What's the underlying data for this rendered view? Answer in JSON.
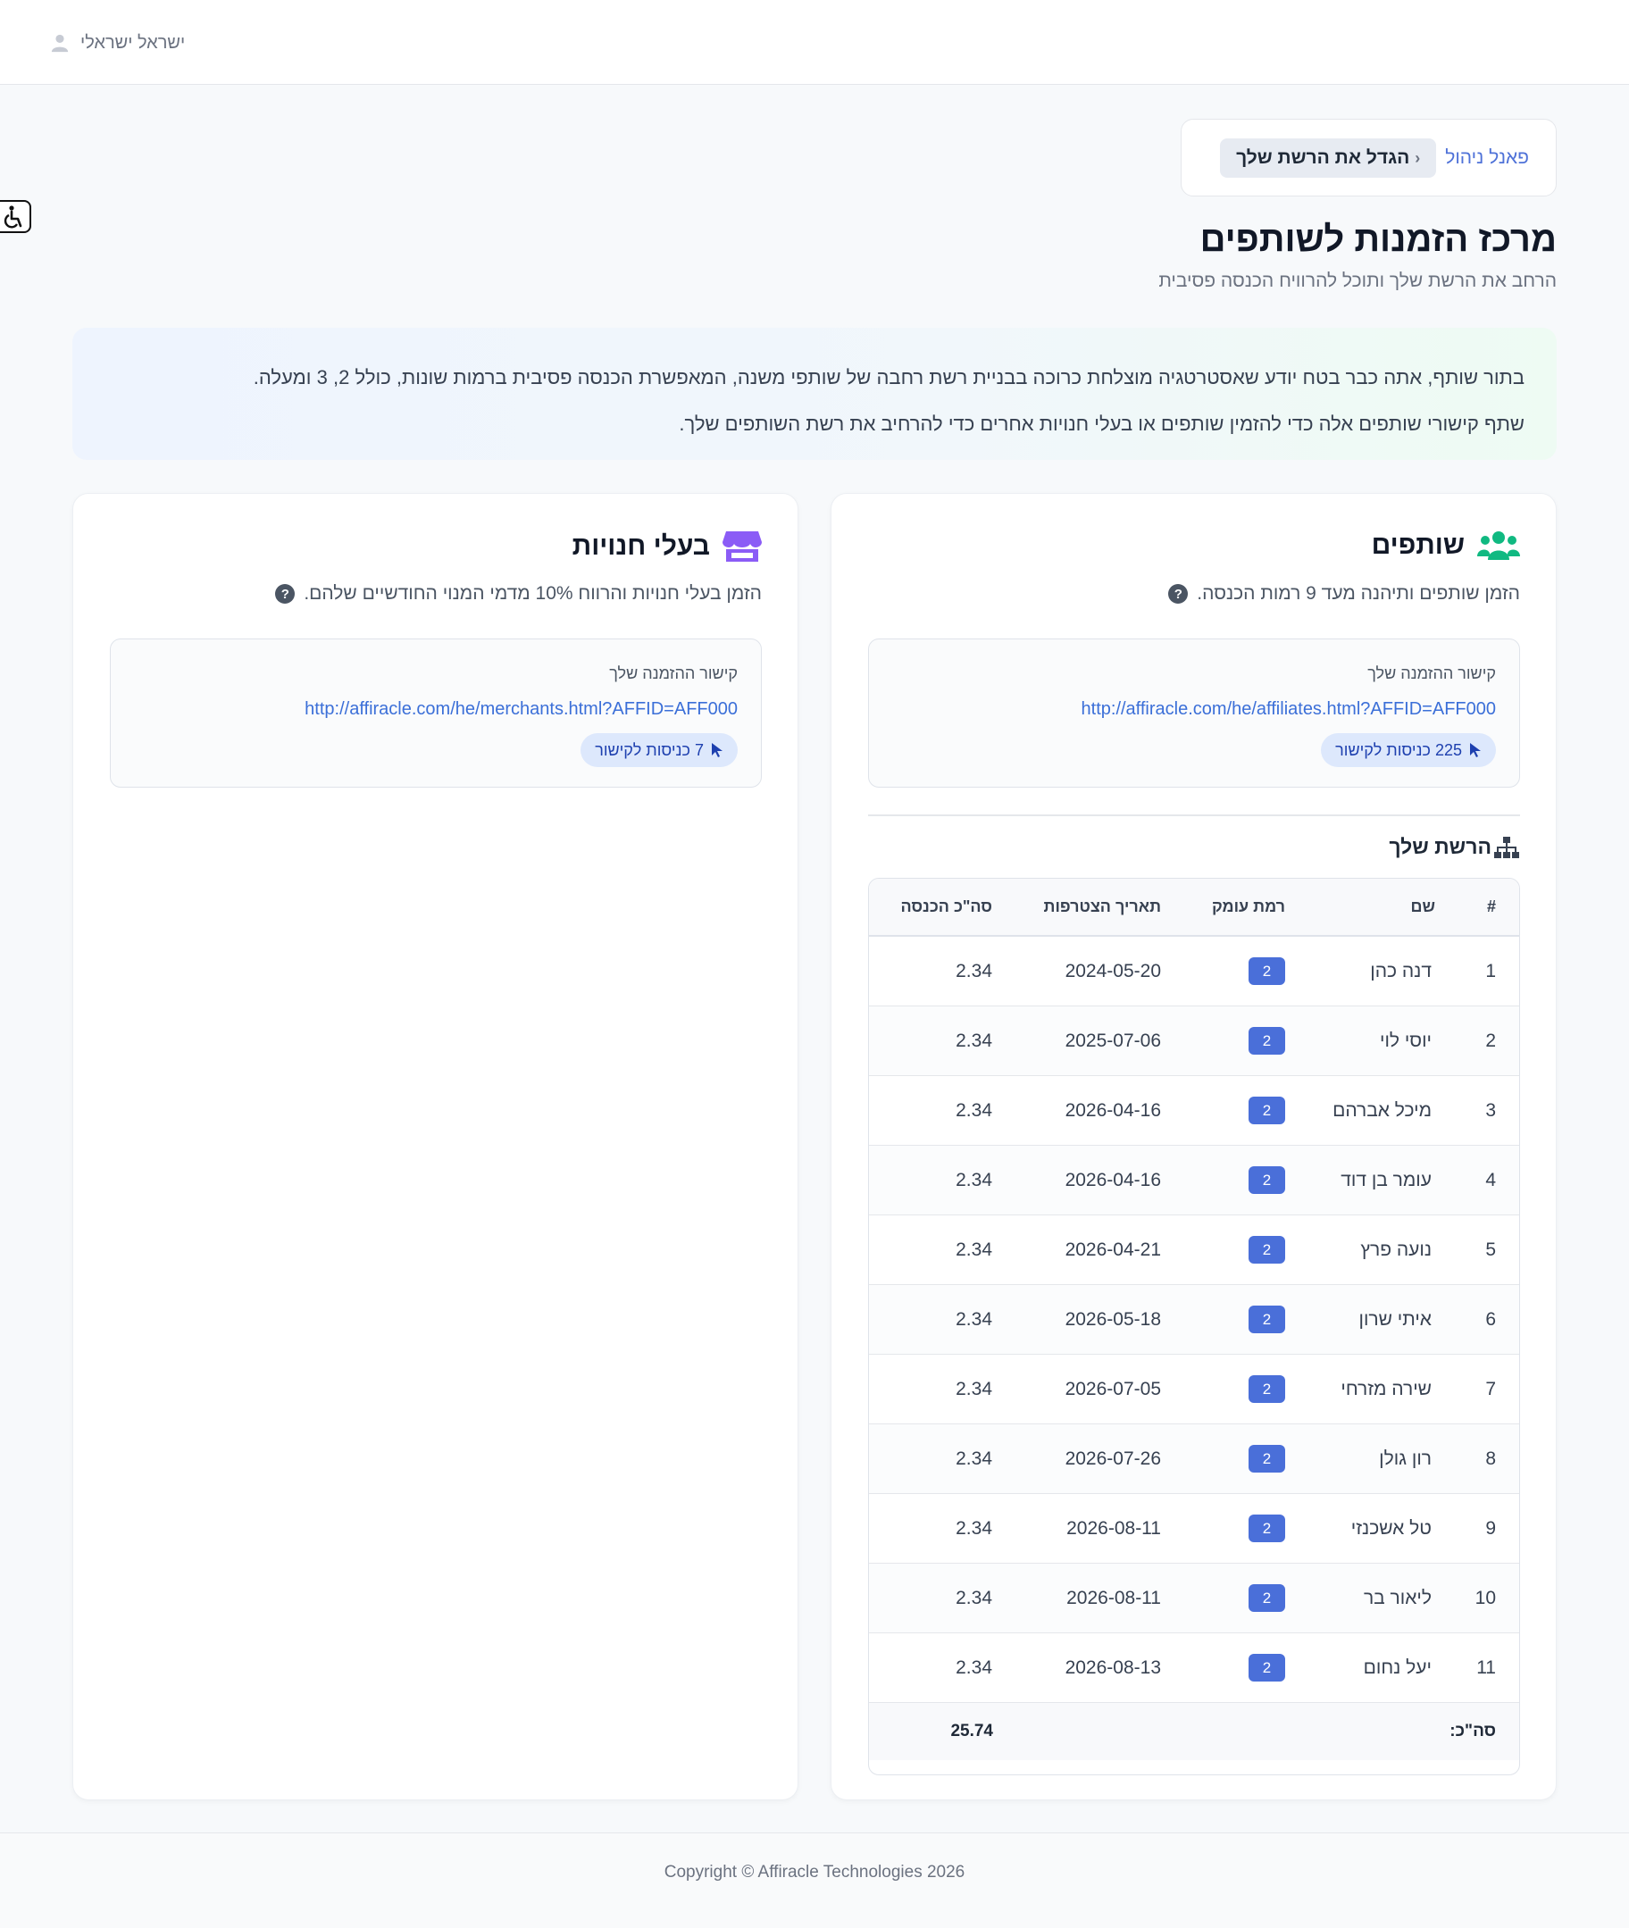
{
  "header": {
    "user_name": "ישראל ישראלי"
  },
  "breadcrumb": {
    "root": "פאנל ניהול",
    "current": "הגדל את הרשת שלך"
  },
  "page": {
    "title": "מרכז הזמנות לשותפים",
    "subtitle": "הרחב את הרשת שלך ותוכל להרוויח הכנסה פסיבית"
  },
  "intro": {
    "line1": "בתור שותף, אתה כבר בטח יודע שאסטרטגיה מוצלחת כרוכה בבניית רשת רחבה של שותפי משנה, המאפשרת הכנסה פסיבית ברמות שונות, כולל 2, 3 ומעלה.",
    "line2": "שתף קישורי שותפים אלה כדי להזמין שותפים או בעלי חנויות אחרים כדי להרחיב את רשת השותפים שלך."
  },
  "affiliates": {
    "title": "שותפים",
    "description": "הזמן שותפים ותיהנה מעד 9 רמות הכנסה.",
    "link_label": "קישור ההזמנה שלך",
    "link_url": "http://affiracle.com/he/affiliates.html?AFFID=AFF000",
    "visits": "225 כניסות לקישור",
    "network_title": "הרשת שלך",
    "table": {
      "headers": [
        "#",
        "שם",
        "רמת עומק",
        "תאריך הצטרפות",
        "סה\"כ הכנסה"
      ],
      "rows": [
        {
          "num": "1",
          "name": "דנה כהן",
          "depth": "2",
          "date": "2024-05-20",
          "total": "2.34"
        },
        {
          "num": "2",
          "name": "יוסי לוי",
          "depth": "2",
          "date": "2025-07-06",
          "total": "2.34"
        },
        {
          "num": "3",
          "name": "מיכל אברהם",
          "depth": "2",
          "date": "2026-04-16",
          "total": "2.34"
        },
        {
          "num": "4",
          "name": "עומר בן דוד",
          "depth": "2",
          "date": "2026-04-16",
          "total": "2.34"
        },
        {
          "num": "5",
          "name": "נועה פרץ",
          "depth": "2",
          "date": "2026-04-21",
          "total": "2.34"
        },
        {
          "num": "6",
          "name": "איתי שרון",
          "depth": "2",
          "date": "2026-05-18",
          "total": "2.34"
        },
        {
          "num": "7",
          "name": "שירה מזרחי",
          "depth": "2",
          "date": "2026-07-05",
          "total": "2.34"
        },
        {
          "num": "8",
          "name": "רון גולן",
          "depth": "2",
          "date": "2026-07-26",
          "total": "2.34"
        },
        {
          "num": "9",
          "name": "טל אשכנזי",
          "depth": "2",
          "date": "2026-08-11",
          "total": "2.34"
        },
        {
          "num": "10",
          "name": "ליאור בר",
          "depth": "2",
          "date": "2026-08-11",
          "total": "2.34"
        },
        {
          "num": "11",
          "name": "יעל נחום",
          "depth": "2",
          "date": "2026-08-13",
          "total": "2.34"
        }
      ],
      "footer_label": "סה\"כ:",
      "footer_total": "25.74"
    }
  },
  "merchants": {
    "title": "בעלי חנויות",
    "description": "הזמן בעלי חנויות והרווח 10% מדמי המנוי החודשיים שלהם.",
    "link_label": "קישור ההזמנה שלך",
    "link_url": "http://affiracle.com/he/merchants.html?AFFID=AFF000",
    "visits": "7 כניסות לקישור"
  },
  "footer": {
    "copyright": "Copyright © Affiracle Technologies 2026"
  },
  "colors": {
    "accent": "#4a6fd9",
    "affiliates_icon": "#10b981",
    "merchants_icon": "#8b5cf6",
    "link": "#3b6fd8"
  },
  "icons": [
    "user-icon",
    "accessibility-icon",
    "chevron-left-icon",
    "users-icon",
    "store-icon",
    "question-circle-icon",
    "cursor-icon",
    "sitemap-icon"
  ]
}
